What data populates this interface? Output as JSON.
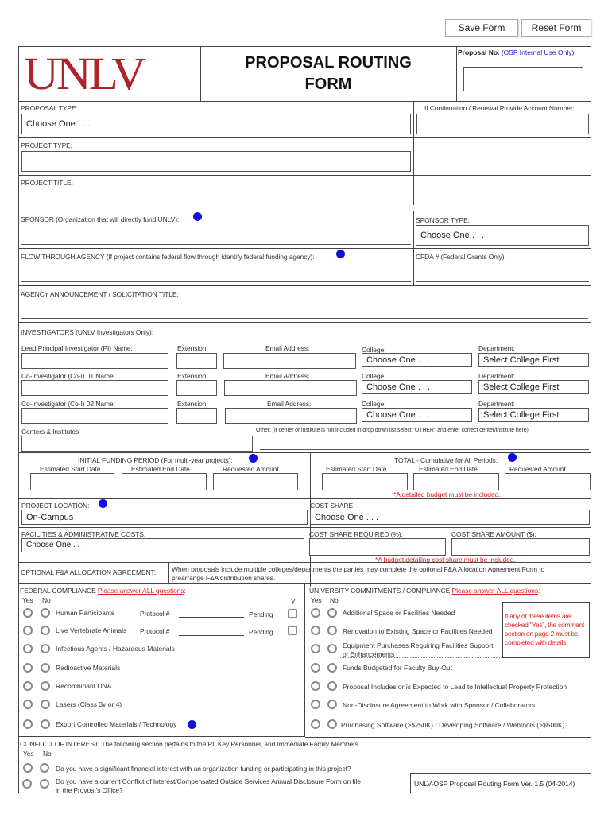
{
  "toolbar": {
    "save_label": "Save Form",
    "reset_label": "Reset Form"
  },
  "header": {
    "logo_text": "UNLV",
    "logo_color": "#b0232a",
    "title_line1": "PROPOSAL ROUTING",
    "title_line2": "FORM",
    "proposal_no_label": "Proposal No.",
    "proposal_no_link": "(OSP Internal Use Only)",
    "proposal_no_suffix": ":"
  },
  "proposal_type": {
    "label": "PROPOSAL TYPE:",
    "value": "Choose One . . ."
  },
  "account_number": {
    "label": "If Continuation / Renewal Provide Account Number:",
    "value": ""
  },
  "project_type": {
    "label": "PROJECT TYPE:",
    "value": ""
  },
  "project_title": {
    "label": "PROJECT TITLE:"
  },
  "sponsor": {
    "label": "SPONSOR (Organization that will directly fund UNLV):"
  },
  "sponsor_type": {
    "label": "SPONSOR TYPE:",
    "value": "Choose One . . ."
  },
  "flow_through": {
    "label": "FLOW THROUGH AGENCY (If project contains federal flow through identify federal funding agency):"
  },
  "cfda": {
    "label": "CFDA # (Federal Grants Only):"
  },
  "announcement": {
    "label": "AGENCY ANNOUNCEMENT / SOLICITATION TITLE:"
  },
  "investigators": {
    "label": "INVESTIGATORS (UNLV Investigators Only):",
    "rows": [
      {
        "name_label": "Lead Principal Investigator (PI) Name:",
        "ext_label": "Extension:",
        "email_label": "Email Address:",
        "college_label": "College:",
        "college_value": "Choose One . . .",
        "dept_label": "Department:",
        "dept_value": "Select College First"
      },
      {
        "name_label": "Co-Investigator (Co-I) 01 Name:",
        "ext_label": "Extension:",
        "email_label": "Email Address:",
        "college_label": "College:",
        "college_value": "Choose One . . .",
        "dept_label": "Department:",
        "dept_value": "Select College First"
      },
      {
        "name_label": "Co-Investigator (Co-I) 02 Name:",
        "ext_label": "Extension:",
        "email_label": "Email Address:",
        "college_label": "College:",
        "college_value": "Choose One . . .",
        "dept_label": "Department:",
        "dept_value": "Select College First"
      }
    ],
    "centers_label": "Centers & Institutes",
    "other_label": "Other: (If center or institute is not included in drop down list select \"OTHER\" and enter correct center/institute here)"
  },
  "funding": {
    "initial_label": "INITIAL FUNDING PERIOD (For multi-year projects):",
    "total_label": "TOTAL - Cumulative for All Periods:",
    "start_label": "Estimated Start Date",
    "end_label": "Estimated End Date",
    "amount_label": "Requested Amount",
    "budget_note": "*A detailed budget must be included."
  },
  "location": {
    "label": "PROJECT LOCATION:",
    "value": "On-Campus"
  },
  "cost_share": {
    "label": "COST SHARE:",
    "value": "Choose One . . ."
  },
  "fa_costs": {
    "label": "FACILITIES & ADMINISTRATIVE COSTS:",
    "value": "Choose One . . ."
  },
  "cost_share_required": {
    "label": "COST SHARE REQUIRED (%):"
  },
  "cost_share_amount": {
    "label": "COST SHARE AMOUNT ($):"
  },
  "cost_share_note": "*A budget detailing cost share must be included.",
  "fa_allocation": {
    "label": "OPTIONAL F&A ALLOCATION AGREEMENT:",
    "text_line1": "When proposals include multiple colleges/departments the parties may complete the optional F&A Allocation Agreement Form to",
    "text_line2": "prearrange F&A distribution shares."
  },
  "federal": {
    "title": "FEDERAL COMPLIANCE",
    "answer_all": "Please answer ALL questions",
    "colon": ":",
    "yes": "Yes",
    "no": "No",
    "y": "Y",
    "protocol_label": "Protocol #",
    "pending_label": "Pending",
    "items": [
      "Human Participants",
      "Live Vertebrate Animals",
      "Infectious Agents / Hazardous Materials",
      "Radioactive Materials",
      "Recombinant DNA",
      "Lasers (Class 3v or 4)",
      "Export Controlled Materials / Technology"
    ]
  },
  "university": {
    "title": "UNIVERSITY COMMITMENTS / COMPLIANCE",
    "answer_all": "Please answer ALL questions",
    "colon": ":",
    "yes": "Yes",
    "no": "No",
    "items": [
      "Additional Space or Facilities Needed",
      "Renovation to Existing Space or Facilities Needed",
      "Equipment Purchases Requiring Facilities Support",
      "Funds Budgeted for Faculty Buy-Out",
      "Proposal Includes or is Expected to Lead to Intellectual Property Protection",
      "Non-Disclosure Agreement to Work with Sponsor / Collaborators",
      "Purchasing Software (>$250K) / Developing Software / Webtools (>$500K)"
    ],
    "item3_line2": "or Enhancements",
    "note": [
      "If any of these items are",
      "checked \"Yes\", the comment",
      "section on page 2 must be",
      "completed with details."
    ]
  },
  "conflict": {
    "title": "CONFLICT OF INTEREST: The following section pertains to the PI, Key Personnel, and Immediate Family Members",
    "yes": "Yes",
    "no": "No",
    "q1": "Do you have a significant financial interest with an organization funding or participating in this project?",
    "q2_line1": "Do you have a current Conflict of Interest/Compensated Outside Services Annual Disclosure Form on file",
    "q2_line2": "in the Provost's Office?"
  },
  "footer": {
    "version": "UNLV-OSP Proposal Routing Form Ver. 1.5 (04-2014)"
  }
}
